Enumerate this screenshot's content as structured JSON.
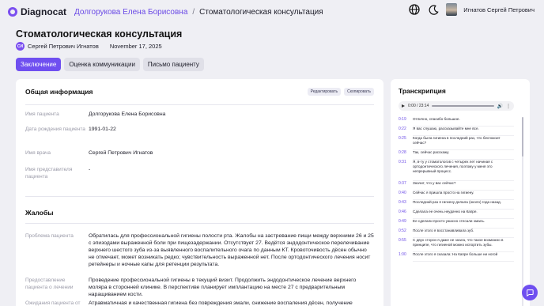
{
  "app": {
    "logo_text": "Diagnocat"
  },
  "breadcrumb": {
    "patient": "Долгорукова Елена Борисовна",
    "separator": "/",
    "current": "Стоматологическая консультация"
  },
  "user": {
    "name": "Игнатов Сергей Петрович"
  },
  "page": {
    "title": "Стоматологическая консультация",
    "author_initials": "СИ",
    "author": "Сергей Петрович Игнатов",
    "date": "November 17, 2025"
  },
  "tabs": [
    "Заключение",
    "Оценка коммуникации",
    "Письмо пациенту"
  ],
  "general": {
    "title": "Общая информация",
    "edit": "Редактировать",
    "copy": "Скопировать",
    "rows": [
      {
        "label": "Имя пациента",
        "value": "Долгорукова Елена Борисовна"
      },
      {
        "label": "Дата рождения пациента",
        "value": "1991-01-22"
      },
      {
        "label": "Имя врача",
        "value": "Сергей Петрович Игнатов"
      },
      {
        "label": "Имя представителя пациента",
        "value": "-"
      }
    ]
  },
  "complaints": {
    "title": "Жалобы",
    "rows": [
      {
        "label": "Проблема пациента",
        "value": "Обратилась для профессиональной гигиены полости рта. Жалобы на застревание пищи между верхними 26 и 25 с эпизодами выраженной боли при пищезадержании. Отсутствует 27. Ведётся эндодонтическое перелечивание верхнего шестого зуба из-за выявленного воспалительного очага по данным КТ. Кровоточивость дёсен обычно не отмечает, может возникать редко; чувствительность выраженной нет. После ортодонтического лечения носит ретейнеры и ночные капы для ретенции результата."
      },
      {
        "label": "Предоставление пациента о лечении",
        "value": "Проведение профессиональной гигиены в текущий визит. Продолжить эндодонтическое лечение верхнего моляра в сторонней клинике. В перспективе планирует имплантацию на месте 27 с предварительным наращиванием кости."
      },
      {
        "label": "Ожидания пациента от",
        "value": "Атравматичная и качественная гигиена без повреждения эмали, снижение воспаления дёсен, получение подробных"
      }
    ]
  },
  "transcript": {
    "title": "Транскрипция",
    "player_time": "0:00 / 23:14",
    "items": [
      {
        "time": "0:19",
        "text": "Отлично, спасибо большое."
      },
      {
        "time": "0:22",
        "text": "Я вас слушаю, рассказывайте мне все."
      },
      {
        "time": "0:25",
        "text": "Когда была гигиена в последний раз, что беспокоит сейчас?"
      },
      {
        "time": "0:28",
        "text": "Так, сейчас расскажу."
      },
      {
        "time": "0:31",
        "text": "Я, в-ту у стоматологов с четырех лет начиная с ортодонтического лечения, поэтому у меня это непрерывный процесс."
      },
      {
        "time": "0:37",
        "text": "Значит, что у вас сейчас?"
      },
      {
        "time": "0:40",
        "text": "Сейчас я пришла просто на гигиену."
      },
      {
        "time": "0:43",
        "text": "Последний раз я гигиену делала (около) года назад."
      },
      {
        "time": "0:46",
        "text": "Сделала ее очень неудачно на Капре."
      },
      {
        "time": "0:49",
        "text": "Ее сделали просто ужасно стесали эмаль."
      },
      {
        "time": "0:52",
        "text": "После этого я восстанавливала зуб."
      },
      {
        "time": "0:55",
        "text": "С двух сторон я даже не знала, что такое возможно в принципе, что гигиеной можно испортить зубы."
      },
      {
        "time": "1:00",
        "text": "После этого я сказала: На Капре больше ни ногой"
      }
    ]
  }
}
